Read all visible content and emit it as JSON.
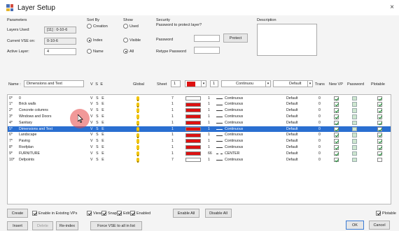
{
  "window": {
    "title": "Layer Setup",
    "close_glyph": "×"
  },
  "parameters": {
    "group_label": "Parameters",
    "layers_used_label": "Layers Used:",
    "layers_used_value": "[11] : 0-10-6",
    "current_vse_label": "Current VSE on:",
    "current_vse_value": "0-10-6",
    "active_layer_label": "Active Layer:",
    "active_layer_value": "4"
  },
  "sort_by": {
    "label": "Sort By",
    "options": [
      "Creation",
      "Index",
      "Name"
    ],
    "selected": "Index"
  },
  "show": {
    "label": "Show",
    "options": [
      "Used",
      "Visible",
      "All"
    ],
    "selected": "All"
  },
  "security": {
    "label": "Security",
    "prompt": "Password to protect layer?",
    "password_label": "Password",
    "retype_label": "Retype Password",
    "protect_button": "Protect"
  },
  "description": {
    "label": "Description"
  },
  "edit_row": {
    "name_label": "Name :",
    "name_value": "Dimensions and Text",
    "vse_header": "V S E",
    "global_header": "Global",
    "sheet_label": "Sheet",
    "sheet_value": "1",
    "color_value": "7",
    "lineweight_value": "1",
    "linetype_value": "Continuou",
    "pen_value": "Default",
    "trans_header": "Trans",
    "newvp_header": "New VP",
    "password_header": "Password",
    "plotable_header": "Plotable",
    "color_accent": "#dd1111"
  },
  "layers": [
    {
      "index": "0*",
      "name": "0",
      "vse": "V S E",
      "sheet": "7",
      "color": "#ffffff",
      "lw": "1",
      "linetype": "Continuous",
      "pen": "Default",
      "trans": "0",
      "newvp": true,
      "password": false,
      "plotable": true
    },
    {
      "index": "1*",
      "name": "Brick walls",
      "vse": "V S E",
      "sheet": "1",
      "color": "#dd1111",
      "lw": "1",
      "linetype": "Continuous",
      "pen": "Default",
      "trans": "0",
      "newvp": true,
      "password": false,
      "plotable": true
    },
    {
      "index": "2*",
      "name": "Concrete columns",
      "vse": "V S E",
      "sheet": "1",
      "color": "#dd1111",
      "lw": "1",
      "linetype": "Continuous",
      "pen": "Default",
      "trans": "0",
      "newvp": true,
      "password": false,
      "plotable": true
    },
    {
      "index": "3*",
      "name": "Windows and Doors",
      "vse": "V S E",
      "sheet": "1",
      "color": "#dd1111",
      "lw": "1",
      "linetype": "Continuous",
      "pen": "Default",
      "trans": "0",
      "newvp": true,
      "password": false,
      "plotable": true
    },
    {
      "index": "4*",
      "name": "Sanitary",
      "vse": "V S E",
      "sheet": "1",
      "color": "#dd1111",
      "lw": "1",
      "linetype": "Continuous",
      "pen": "Default",
      "trans": "0",
      "newvp": true,
      "password": false,
      "plotable": true
    },
    {
      "index": "5*",
      "name": "Dimensions and Text",
      "vse": "V S E",
      "sheet": "1",
      "color": "#dd1111",
      "lw": "1",
      "linetype": "Continuous",
      "pen": "Default",
      "trans": "0",
      "newvp": true,
      "password": false,
      "plotable": true,
      "selected": true
    },
    {
      "index": "6*",
      "name": "Landscape",
      "vse": "V S E",
      "sheet": "1",
      "color": "#dd1111",
      "lw": "1",
      "linetype": "Continuous",
      "pen": "Default",
      "trans": "0",
      "newvp": true,
      "password": false,
      "plotable": true
    },
    {
      "index": "7*",
      "name": "Paving",
      "vse": "V S E",
      "sheet": "1",
      "color": "#dd1111",
      "lw": "1",
      "linetype": "Continuous",
      "pen": "Default",
      "trans": "0",
      "newvp": true,
      "password": false,
      "plotable": true
    },
    {
      "index": "8*",
      "name": "Roofplan",
      "vse": "V S E",
      "sheet": "1",
      "color": "#dd1111",
      "lw": "1",
      "linetype": "Continuous",
      "pen": "Default",
      "trans": "0",
      "newvp": true,
      "password": false,
      "plotable": true
    },
    {
      "index": "9*",
      "name": "FURNITURE",
      "vse": "V S E",
      "sheet": "1",
      "color": "#dd1111",
      "lw": "66",
      "linetype": "CENTER",
      "pen": "Default",
      "trans": "0",
      "newvp": true,
      "password": false,
      "plotable": true
    },
    {
      "index": "10*",
      "name": "Defpoints",
      "vse": "V S E",
      "sheet": "7",
      "color": "#ffffff",
      "lw": "1",
      "linetype": "Continuous",
      "pen": "Default",
      "trans": "0",
      "newvp": true,
      "password": false,
      "plotable": false
    }
  ],
  "bottom": {
    "create_button": "Create",
    "enable_existing_vps": "Enable in Existing VPs",
    "view_label": "View",
    "snap_label": "Snap",
    "edit_label": "Edit",
    "enabled_label": "Enabled",
    "enable_all_button": "Enable All",
    "disable_all_button": "Disable All",
    "plotable_label": "Plotable",
    "insert_button": "Insert",
    "delete_button": "Delete",
    "reindex_button": "Re-index",
    "force_vse_button": "Force VSE to all in list",
    "ok_button": "OK",
    "cancel_button": "Cancel"
  }
}
